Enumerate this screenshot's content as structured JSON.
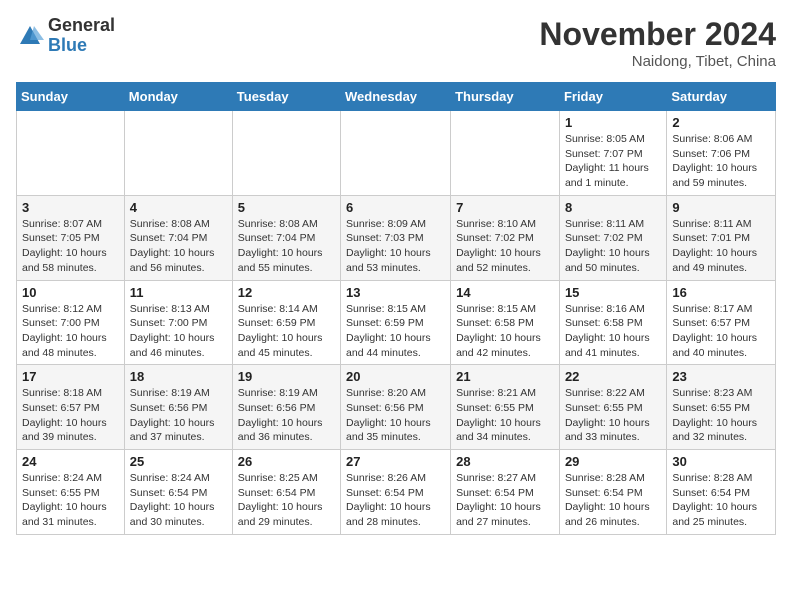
{
  "logo": {
    "general": "General",
    "blue": "Blue"
  },
  "title": "November 2024",
  "location": "Naidong, Tibet, China",
  "days_of_week": [
    "Sunday",
    "Monday",
    "Tuesday",
    "Wednesday",
    "Thursday",
    "Friday",
    "Saturday"
  ],
  "weeks": [
    [
      {
        "day": "",
        "info": ""
      },
      {
        "day": "",
        "info": ""
      },
      {
        "day": "",
        "info": ""
      },
      {
        "day": "",
        "info": ""
      },
      {
        "day": "",
        "info": ""
      },
      {
        "day": "1",
        "info": "Sunrise: 8:05 AM\nSunset: 7:07 PM\nDaylight: 11 hours and 1 minute."
      },
      {
        "day": "2",
        "info": "Sunrise: 8:06 AM\nSunset: 7:06 PM\nDaylight: 10 hours and 59 minutes."
      }
    ],
    [
      {
        "day": "3",
        "info": "Sunrise: 8:07 AM\nSunset: 7:05 PM\nDaylight: 10 hours and 58 minutes."
      },
      {
        "day": "4",
        "info": "Sunrise: 8:08 AM\nSunset: 7:04 PM\nDaylight: 10 hours and 56 minutes."
      },
      {
        "day": "5",
        "info": "Sunrise: 8:08 AM\nSunset: 7:04 PM\nDaylight: 10 hours and 55 minutes."
      },
      {
        "day": "6",
        "info": "Sunrise: 8:09 AM\nSunset: 7:03 PM\nDaylight: 10 hours and 53 minutes."
      },
      {
        "day": "7",
        "info": "Sunrise: 8:10 AM\nSunset: 7:02 PM\nDaylight: 10 hours and 52 minutes."
      },
      {
        "day": "8",
        "info": "Sunrise: 8:11 AM\nSunset: 7:02 PM\nDaylight: 10 hours and 50 minutes."
      },
      {
        "day": "9",
        "info": "Sunrise: 8:11 AM\nSunset: 7:01 PM\nDaylight: 10 hours and 49 minutes."
      }
    ],
    [
      {
        "day": "10",
        "info": "Sunrise: 8:12 AM\nSunset: 7:00 PM\nDaylight: 10 hours and 48 minutes."
      },
      {
        "day": "11",
        "info": "Sunrise: 8:13 AM\nSunset: 7:00 PM\nDaylight: 10 hours and 46 minutes."
      },
      {
        "day": "12",
        "info": "Sunrise: 8:14 AM\nSunset: 6:59 PM\nDaylight: 10 hours and 45 minutes."
      },
      {
        "day": "13",
        "info": "Sunrise: 8:15 AM\nSunset: 6:59 PM\nDaylight: 10 hours and 44 minutes."
      },
      {
        "day": "14",
        "info": "Sunrise: 8:15 AM\nSunset: 6:58 PM\nDaylight: 10 hours and 42 minutes."
      },
      {
        "day": "15",
        "info": "Sunrise: 8:16 AM\nSunset: 6:58 PM\nDaylight: 10 hours and 41 minutes."
      },
      {
        "day": "16",
        "info": "Sunrise: 8:17 AM\nSunset: 6:57 PM\nDaylight: 10 hours and 40 minutes."
      }
    ],
    [
      {
        "day": "17",
        "info": "Sunrise: 8:18 AM\nSunset: 6:57 PM\nDaylight: 10 hours and 39 minutes."
      },
      {
        "day": "18",
        "info": "Sunrise: 8:19 AM\nSunset: 6:56 PM\nDaylight: 10 hours and 37 minutes."
      },
      {
        "day": "19",
        "info": "Sunrise: 8:19 AM\nSunset: 6:56 PM\nDaylight: 10 hours and 36 minutes."
      },
      {
        "day": "20",
        "info": "Sunrise: 8:20 AM\nSunset: 6:56 PM\nDaylight: 10 hours and 35 minutes."
      },
      {
        "day": "21",
        "info": "Sunrise: 8:21 AM\nSunset: 6:55 PM\nDaylight: 10 hours and 34 minutes."
      },
      {
        "day": "22",
        "info": "Sunrise: 8:22 AM\nSunset: 6:55 PM\nDaylight: 10 hours and 33 minutes."
      },
      {
        "day": "23",
        "info": "Sunrise: 8:23 AM\nSunset: 6:55 PM\nDaylight: 10 hours and 32 minutes."
      }
    ],
    [
      {
        "day": "24",
        "info": "Sunrise: 8:24 AM\nSunset: 6:55 PM\nDaylight: 10 hours and 31 minutes."
      },
      {
        "day": "25",
        "info": "Sunrise: 8:24 AM\nSunset: 6:54 PM\nDaylight: 10 hours and 30 minutes."
      },
      {
        "day": "26",
        "info": "Sunrise: 8:25 AM\nSunset: 6:54 PM\nDaylight: 10 hours and 29 minutes."
      },
      {
        "day": "27",
        "info": "Sunrise: 8:26 AM\nSunset: 6:54 PM\nDaylight: 10 hours and 28 minutes."
      },
      {
        "day": "28",
        "info": "Sunrise: 8:27 AM\nSunset: 6:54 PM\nDaylight: 10 hours and 27 minutes."
      },
      {
        "day": "29",
        "info": "Sunrise: 8:28 AM\nSunset: 6:54 PM\nDaylight: 10 hours and 26 minutes."
      },
      {
        "day": "30",
        "info": "Sunrise: 8:28 AM\nSunset: 6:54 PM\nDaylight: 10 hours and 25 minutes."
      }
    ]
  ]
}
